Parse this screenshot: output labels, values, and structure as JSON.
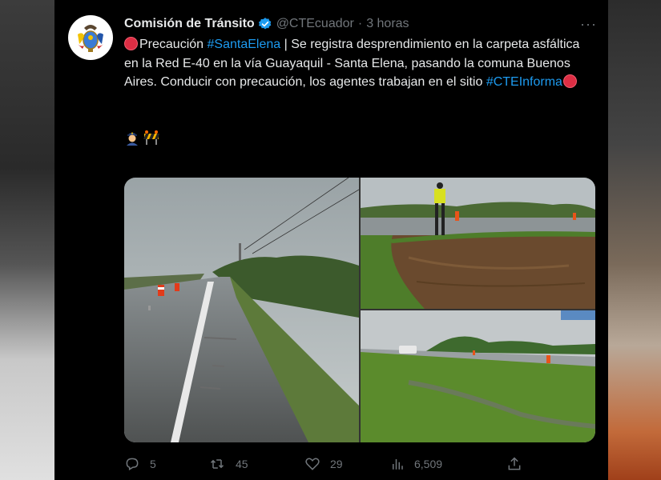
{
  "tweet": {
    "author_name": "Comisión de Tránsito",
    "handle": "@CTEcuador",
    "separator": "·",
    "time": "3 horas",
    "more_glyph": "···",
    "text": {
      "p1": "Precaución ",
      "tag1": "#SantaElena",
      "p2": " | Se registra desprendimiento en la carpeta asfáltica en la Red E-40 en la vía Guayaquil - Santa Elena, pasando la comuna Buenos Aires. Conducir con precaución, los agentes trabajan en el sitio ",
      "tag2": "#CTEInforma"
    },
    "emojis": [
      "police-officer-emoji",
      "construction-barrier-emoji"
    ]
  },
  "media": [
    {
      "name": "photo-wet-highway-cones"
    },
    {
      "name": "photo-agent-road-collapse"
    },
    {
      "name": "photo-grass-roadside-car"
    }
  ],
  "actions": {
    "replies": "5",
    "retweets": "45",
    "likes": "29",
    "views": "6,509"
  },
  "colors": {
    "background": "#000000",
    "text": "#e7e9ea",
    "muted": "#71767b",
    "link": "#1d9bf0",
    "verified": "#1d9bf0",
    "stop_sign": "#dd2e44"
  }
}
